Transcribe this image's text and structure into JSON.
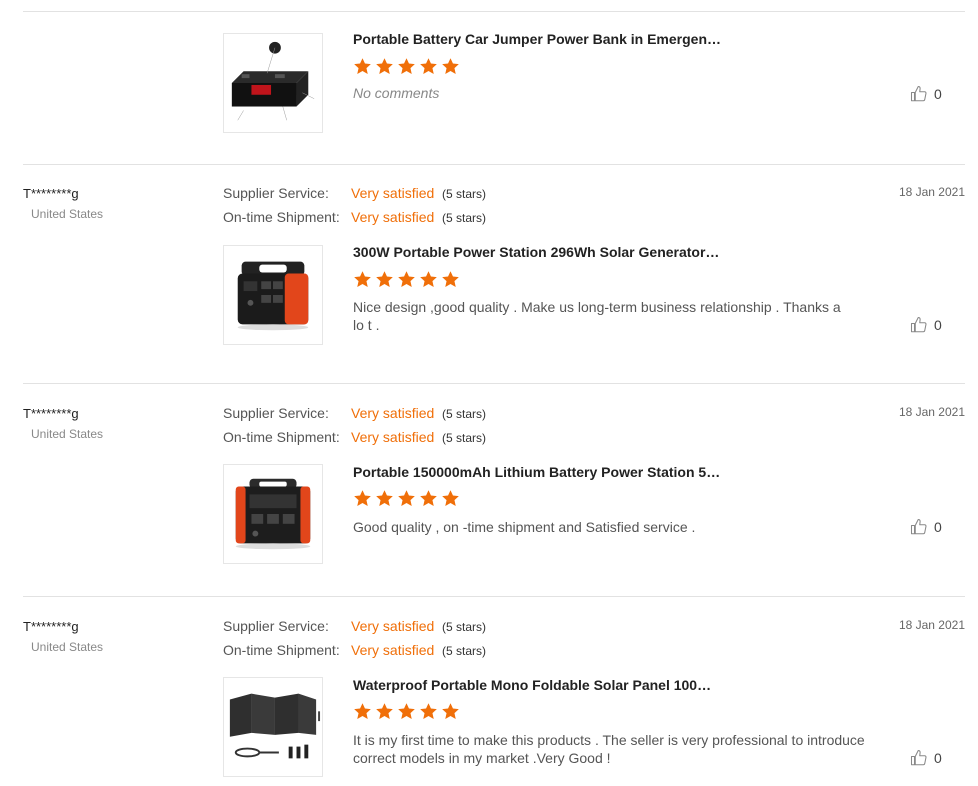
{
  "reviews": [
    {
      "product": {
        "name": "Portable Battery Car Jumper Power Bank in Emergen…",
        "rating": 5,
        "image_icon": "jump-starter-image"
      },
      "comment": "No comments",
      "likes": "0"
    },
    {
      "user": "T********g",
      "country": "United States",
      "date": "18 Jan 2021",
      "supplier_label": "Supplier Service:",
      "supplier_value": "Very satisfied",
      "supplier_stars": "(5 stars)",
      "shipment_label": "On-time Shipment:",
      "shipment_value": "Very satisfied",
      "shipment_stars": "(5 stars)",
      "product": {
        "name": "300W Portable Power Station 296Wh Solar Generator…",
        "rating": 5,
        "image_icon": "power-station-image"
      },
      "comment": "Nice design ,good quality . Make us long-term business relationship . Thanks a lo t .",
      "likes": "0"
    },
    {
      "user": "T********g",
      "country": "United States",
      "date": "18 Jan 2021",
      "supplier_label": "Supplier Service:",
      "supplier_value": "Very satisfied",
      "supplier_stars": "(5 stars)",
      "shipment_label": "On-time Shipment:",
      "shipment_value": "Very satisfied",
      "shipment_stars": "(5 stars)",
      "product": {
        "name": "Portable 150000mAh Lithium Battery Power Station 5…",
        "rating": 5,
        "image_icon": "battery-station-image"
      },
      "comment": "Good quality , on -time shipment and Satisfied service .",
      "likes": "0"
    },
    {
      "user": "T********g",
      "country": "United States",
      "date": "18 Jan 2021",
      "supplier_label": "Supplier Service:",
      "supplier_value": "Very satisfied",
      "supplier_stars": "(5 stars)",
      "shipment_label": "On-time Shipment:",
      "shipment_value": "Very satisfied",
      "shipment_stars": "(5 stars)",
      "product": {
        "name": "Waterproof Portable Mono Foldable Solar Panel 100…",
        "rating": 5,
        "image_icon": "solar-panel-image"
      },
      "comment": "It is my first time to make this products . The seller is very professional to introduce correct models in my market .Very Good !",
      "likes": "0"
    }
  ],
  "colors": {
    "accent": "#f06f09",
    "star": "#f06f09",
    "divider": "#e2e2e2"
  }
}
